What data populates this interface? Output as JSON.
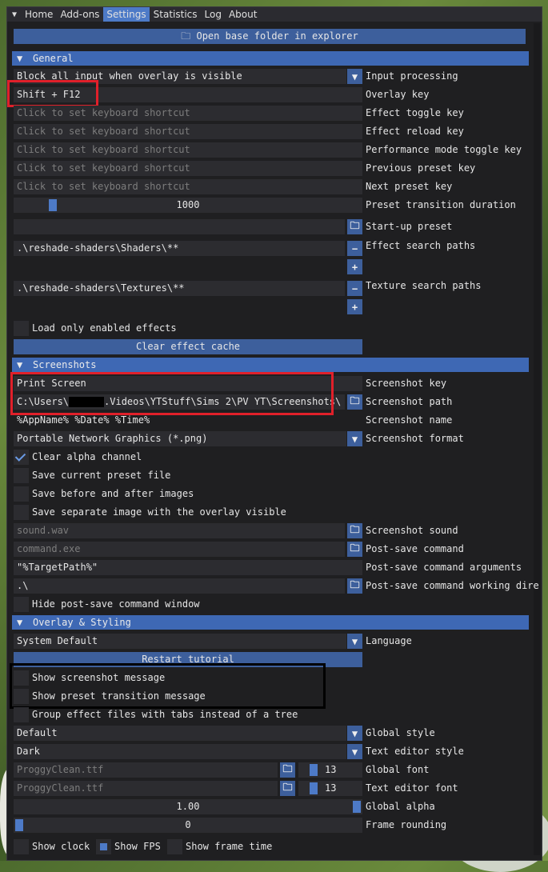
{
  "menu": {
    "tabs": [
      "Home",
      "Add-ons",
      "Settings",
      "Statistics",
      "Log",
      "About"
    ],
    "active": "Settings"
  },
  "open_folder_button": "Open base folder in explorer",
  "general": {
    "header": "General",
    "input_processing": {
      "value": "Block all input when overlay is visible",
      "label": "Input processing"
    },
    "overlay_key": {
      "value": "Shift + F12",
      "label": "Overlay key"
    },
    "shortcut_placeholder": "Click to set keyboard shortcut",
    "shortcut_labels": [
      "Effect toggle key",
      "Effect reload key",
      "Performance mode toggle key",
      "Previous preset key",
      "Next preset key"
    ],
    "transition": {
      "value": "1000",
      "label": "Preset transition duration"
    },
    "startup_preset": {
      "value": "",
      "label": "Start-up preset"
    },
    "effect_paths": {
      "value": ".\\reshade-shaders\\Shaders\\**",
      "label": "Effect search paths"
    },
    "texture_paths": {
      "value": ".\\reshade-shaders\\Textures\\**",
      "label": "Texture search paths"
    },
    "load_only_enabled": "Load only enabled effects",
    "clear_cache": "Clear effect cache"
  },
  "screenshots": {
    "header": "Screenshots",
    "key": {
      "value": "Print Screen",
      "label": "Screenshot key"
    },
    "path": {
      "value_start": "C:\\Users\\",
      "value_end": ".Videos\\YTStuff\\Sims 2\\PV YT\\Screenshots\\",
      "label": "Screenshot path"
    },
    "name": {
      "value": "%AppName% %Date% %Time%",
      "label": "Screenshot name"
    },
    "format": {
      "value": "Portable Network Graphics (*.png)",
      "label": "Screenshot format"
    },
    "clear_alpha": "Clear alpha channel",
    "save_preset": "Save current preset file",
    "save_before_after": "Save before and after images",
    "save_separate": "Save separate image with the overlay visible",
    "sound": {
      "value": "sound.wav",
      "label": "Screenshot sound"
    },
    "post_save": {
      "value": "command.exe",
      "label": "Post-save command"
    },
    "post_args": {
      "value": "\"%TargetPath%\"",
      "label": "Post-save command arguments"
    },
    "post_dir": {
      "value": ".\\",
      "label": "Post-save command working dire"
    },
    "hide_window": "Hide post-save command window"
  },
  "overlay": {
    "header": "Overlay & Styling",
    "language": {
      "value": "System Default",
      "label": "Language"
    },
    "restart_tutorial": "Restart tutorial",
    "show_screenshot_msg": "Show screenshot message",
    "show_preset_msg": "Show preset transition message",
    "group_tabs": "Group effect files with tabs instead of a tree",
    "global_style": {
      "value": "Default",
      "label": "Global style"
    },
    "editor_style": {
      "value": "Dark",
      "label": "Text editor style"
    },
    "global_font": {
      "value": "ProggyClean.ttf",
      "size": "13",
      "label": "Global font"
    },
    "editor_font": {
      "value": "ProggyClean.ttf",
      "size": "13",
      "label": "Text editor font"
    },
    "global_alpha": {
      "value": "1.00",
      "label": "Global alpha",
      "fraction": 1.0
    },
    "frame_rounding": {
      "value": "0",
      "label": "Frame rounding",
      "fraction": 0.0
    },
    "show_clock": "Show clock",
    "show_fps": "Show FPS",
    "show_frame_time": "Show frame time"
  },
  "colors": {
    "accent": "#4d7ac7",
    "header": "#3e68b4",
    "highlight_box": "#e0202a"
  }
}
